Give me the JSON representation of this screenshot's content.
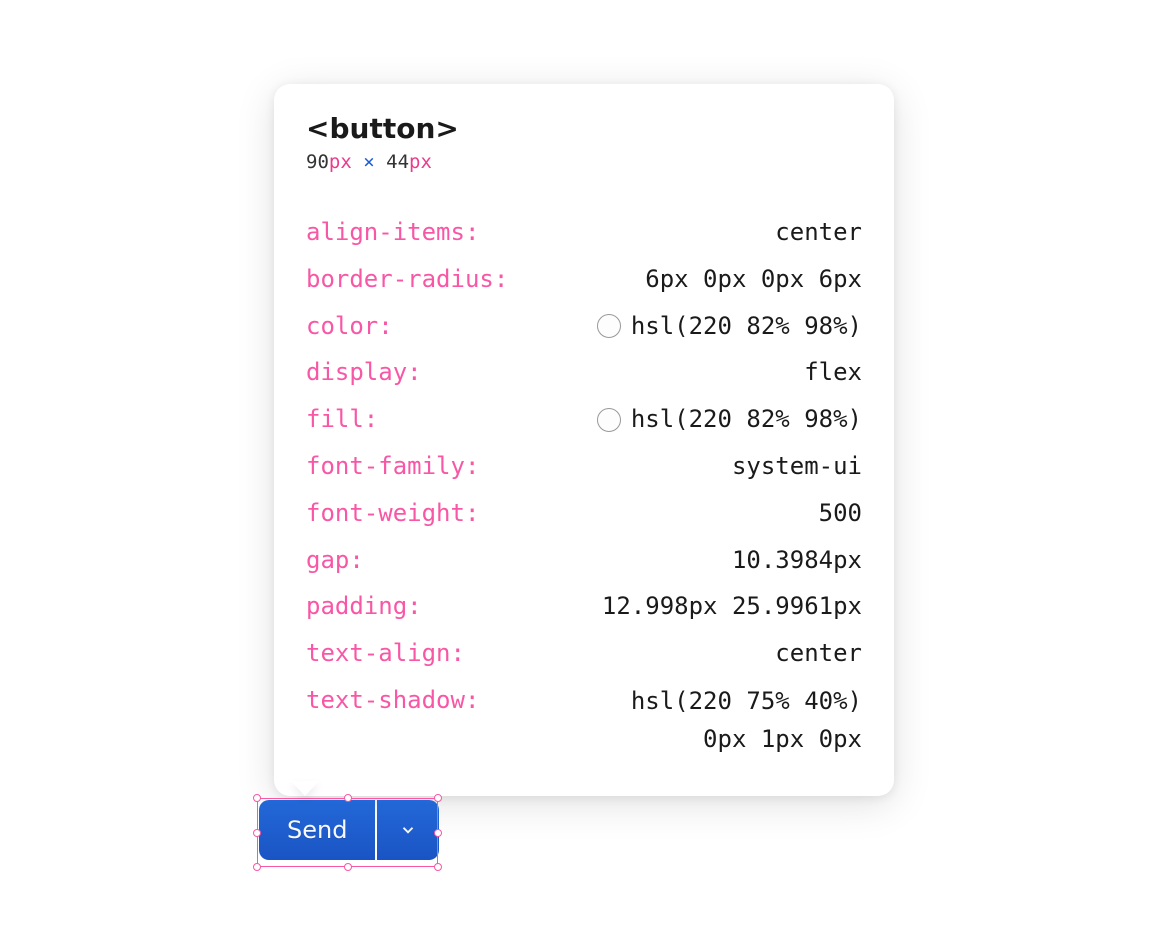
{
  "tooltip": {
    "element_tag": "<button>",
    "dimensions": {
      "width_value": "90",
      "width_unit": "px",
      "separator": "×",
      "height_value": "44",
      "height_unit": "px"
    },
    "properties": [
      {
        "name": "align-items",
        "value": "center",
        "swatch": false
      },
      {
        "name": "border-radius",
        "value": "6px 0px 0px 6px",
        "swatch": false
      },
      {
        "name": "color",
        "value": "hsl(220 82% 98%)",
        "swatch": true
      },
      {
        "name": "display",
        "value": "flex",
        "swatch": false
      },
      {
        "name": "fill",
        "value": "hsl(220 82% 98%)",
        "swatch": true
      },
      {
        "name": "font-family",
        "value": "system-ui",
        "swatch": false
      },
      {
        "name": "font-weight",
        "value": "500",
        "swatch": false
      },
      {
        "name": "gap",
        "value": "10.3984px",
        "swatch": false
      },
      {
        "name": "padding",
        "value": "12.998px 25.9961px",
        "swatch": false
      },
      {
        "name": "text-align",
        "value": "center",
        "swatch": false
      },
      {
        "name": "text-shadow",
        "value": "hsl(220 75% 40%) 0px 1px 0px",
        "swatch": false,
        "multiline": true,
        "line1": "hsl(220 75% 40%)",
        "line2": "0px 1px 0px"
      }
    ]
  },
  "buttons": {
    "send_label": "Send",
    "dropdown_icon": "chevron-down"
  }
}
